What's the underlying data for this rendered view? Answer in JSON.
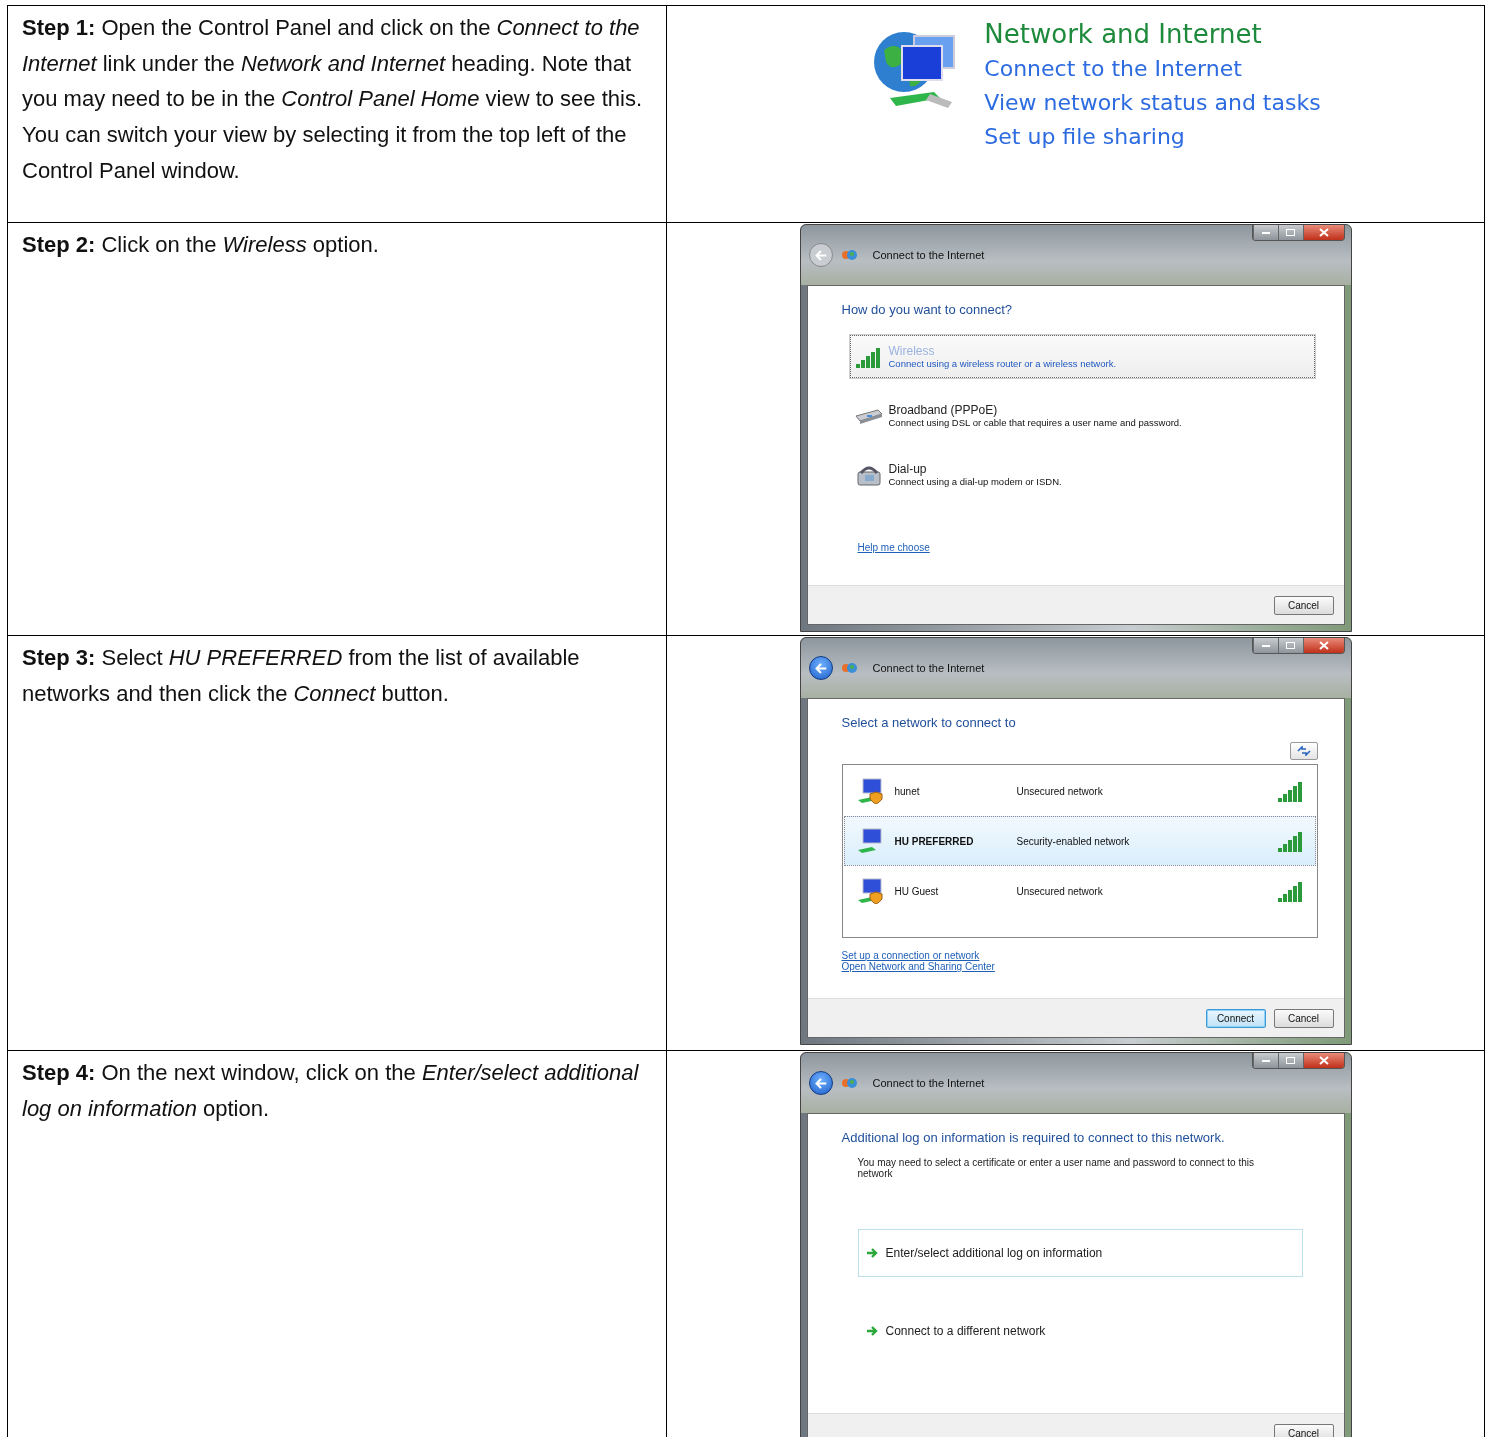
{
  "steps": [
    {
      "instruction": "**Step 1:**  Open the Control Panel and click on the *Connect to the Internet* link under the *Network and Internet* heading. Note that you may need to be in the *Control Panel Home* view to see this. You can switch your view by selecting it from the top left of the Control Panel window.",
      "panel": {
        "kind": "category",
        "heading": "Network and Internet",
        "links": [
          "Connect to the Internet",
          "View network status and tasks",
          "Set up file sharing"
        ]
      }
    },
    {
      "instruction": "**Step 2:** Click on the *Wireless* option.",
      "panel": {
        "kind": "wizard",
        "title": "Connect to the Internet",
        "back_enabled": false,
        "heading": "How do you want to connect?",
        "options": [
          {
            "kind": "wireless",
            "title": "Wireless",
            "description": "Connect using a wireless router or a wireless network.",
            "selected": true
          },
          {
            "kind": "broadband",
            "title": "Broadband (PPPoE)",
            "description": "Connect using DSL or cable that requires a user name and password.",
            "selected": false
          },
          {
            "kind": "dialup",
            "title": "Dial-up",
            "description": "Connect using a dial-up modem or ISDN.",
            "selected": false
          }
        ],
        "links": [
          "Help me choose"
        ],
        "buttons": [
          {
            "label": "Cancel",
            "focused": false
          }
        ]
      }
    },
    {
      "instruction": "**Step 3:** Select *HU PREFERRED* from the list of available networks and then click the *Connect* button.",
      "panel": {
        "kind": "wizard",
        "title": "Connect to the Internet",
        "back_enabled": true,
        "heading": "Select a network to connect to",
        "networks": [
          {
            "name": "hunet",
            "security": "Unsecured network",
            "secured": false,
            "selected": false
          },
          {
            "name": "HU PREFERRED",
            "security": "Security-enabled network",
            "secured": true,
            "selected": true
          },
          {
            "name": "HU Guest",
            "security": "Unsecured network",
            "secured": false,
            "selected": false
          }
        ],
        "links": [
          "Set up a connection or network",
          "Open Network and Sharing Center"
        ],
        "buttons": [
          {
            "label": "Connect",
            "focused": true
          },
          {
            "label": "Cancel",
            "focused": false
          }
        ]
      }
    },
    {
      "instruction": "**Step 4:** On the next window, click on the *Enter/select additional log on information* option.",
      "panel": {
        "kind": "wizard",
        "title": "Connect to the Internet",
        "back_enabled": true,
        "heading": "Additional log on information is required to connect to this network.",
        "description": "You may need to select a certificate or enter a user name and password to connect to this network",
        "choices": [
          {
            "label": "Enter/select additional log on information",
            "selected": true
          },
          {
            "label": "Connect to a different network",
            "selected": false
          }
        ],
        "buttons": [
          {
            "label": "Cancel",
            "focused": false
          }
        ]
      }
    }
  ]
}
